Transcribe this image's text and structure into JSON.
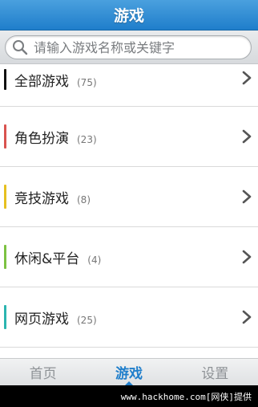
{
  "header": {
    "title": "游戏"
  },
  "search": {
    "placeholder": "请输入游戏名称或关键字"
  },
  "categories": [
    {
      "label": "全部游戏",
      "count": "(75)",
      "accent": "#111111"
    },
    {
      "label": "角色扮演",
      "count": "(23)",
      "accent": "#d9534f"
    },
    {
      "label": "竞技游戏",
      "count": "(8)",
      "accent": "#e6c020"
    },
    {
      "label": "休闲&平台",
      "count": "(4)",
      "accent": "#7cc242"
    },
    {
      "label": "网页游戏",
      "count": "(25)",
      "accent": "#2bb5b0"
    }
  ],
  "tabs": [
    {
      "label": "首页",
      "active": false
    },
    {
      "label": "游戏",
      "active": true
    },
    {
      "label": "设置",
      "active": false
    }
  ],
  "footer": {
    "text": "www.hackhome.com[网侠]提供"
  },
  "colors": {
    "accent": "#1f7ecb"
  }
}
